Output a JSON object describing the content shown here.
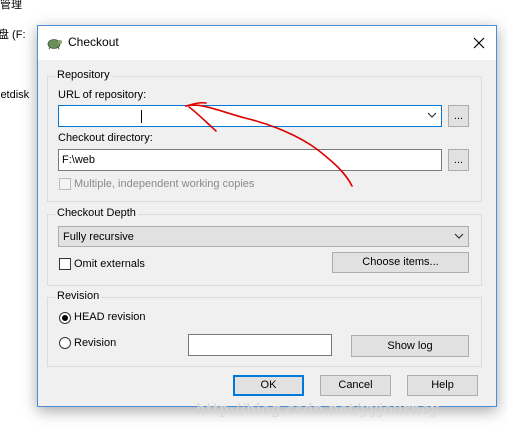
{
  "background": {
    "line1": "管理",
    "line2": "盘 (F:",
    "line3": "letdisk"
  },
  "dialog": {
    "title": "Checkout",
    "icons": {
      "app": "tortoise-svn-icon",
      "close": "close-icon"
    },
    "repository": {
      "group_title": "Repository",
      "url_label": "URL of repository:",
      "url_value": "",
      "url_browse": "...",
      "dir_label": "Checkout directory:",
      "dir_value": "F:\\web",
      "dir_browse": "...",
      "multiple_label": "Multiple, independent working copies",
      "multiple_checked": false
    },
    "depth": {
      "group_title": "Checkout Depth",
      "selected": "Fully recursive",
      "omit_label": "Omit externals",
      "omit_checked": false,
      "choose_items": "Choose items..."
    },
    "revision": {
      "group_title": "Revision",
      "head_label": "HEAD revision",
      "revision_label": "Revision",
      "revision_value": "",
      "show_log": "Show log",
      "selected": "HEAD revision"
    },
    "buttons": {
      "ok": "OK",
      "cancel": "Cancel",
      "help": "Help"
    }
  },
  "watermark": "http://blog.csdn.net/yyjourney",
  "colors": {
    "annotation": "#e00000",
    "focus_border": "#0078d7",
    "dialog_border": "#4a8fd6"
  }
}
